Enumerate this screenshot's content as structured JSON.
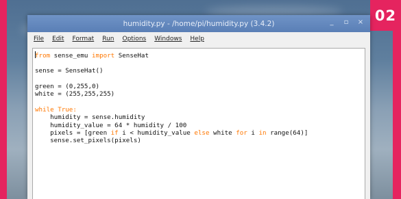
{
  "badge": {
    "label": "02"
  },
  "window": {
    "title": "humidity.py - /home/pi/humidity.py (3.4.2)",
    "controls": {
      "minimize": "_",
      "maximize": "▫",
      "close": "×"
    }
  },
  "menu": {
    "file": "File",
    "edit": "Edit",
    "format": "Format",
    "run": "Run",
    "options": "Options",
    "windows": "Windows",
    "help": "Help"
  },
  "code": {
    "l1_kw1": "from",
    "l1_mod": " sense_emu ",
    "l1_kw2": "import",
    "l1_name": " SenseHat",
    "l3": "sense = SenseHat()",
    "l5": "green = (0,255,0)",
    "l6": "white = (255,255,255)",
    "l8_kw": "while True:",
    "l9": "    humidity = sense.humidity",
    "l10": "    humidity_value = 64 * humidity / 100",
    "l11_a": "    pixels = [green ",
    "l11_kw1": "if",
    "l11_b": " i < humidity_value ",
    "l11_kw2": "else",
    "l11_c": " white ",
    "l11_kw3": "for",
    "l11_d": " i ",
    "l11_kw4": "in",
    "l11_e": " range(64)]",
    "l12": "    sense.set_pixels(pixels)"
  },
  "colors": {
    "frame_accent": "#e5245f",
    "titlebar": "#6f93c6",
    "keyword": "#ff7700"
  }
}
